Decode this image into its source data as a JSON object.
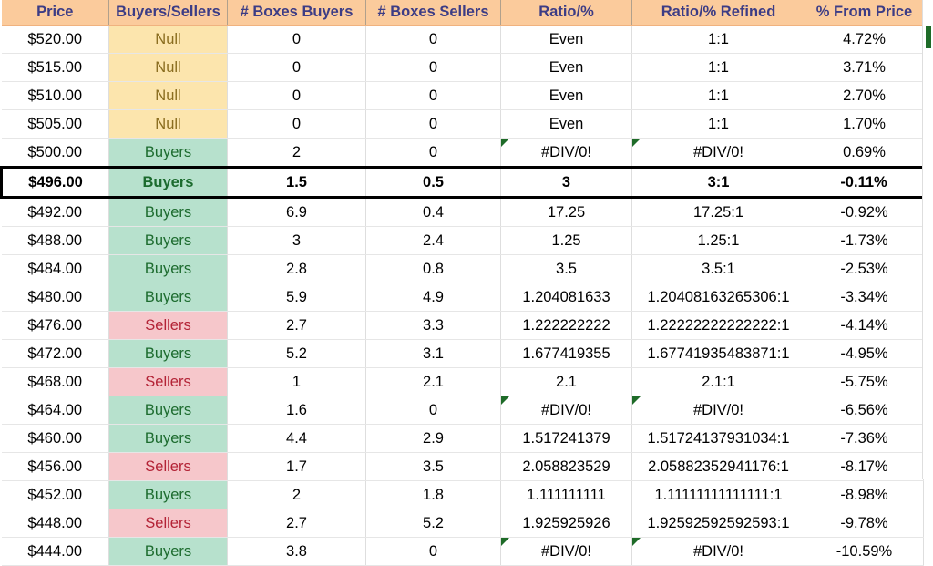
{
  "table": {
    "columns": [
      {
        "key": "price",
        "label": "Price"
      },
      {
        "key": "bs",
        "label": "Buyers/Sellers"
      },
      {
        "key": "bb",
        "label": "# Boxes Buyers"
      },
      {
        "key": "bsl",
        "label": "# Boxes Sellers"
      },
      {
        "key": "ratio",
        "label": "Ratio/%"
      },
      {
        "key": "refined",
        "label": "Ratio/% Refined"
      },
      {
        "key": "pct",
        "label": "% From Price"
      }
    ],
    "rows": [
      {
        "price": "$520.00",
        "bs": "Null",
        "fill": "null",
        "bb": "0",
        "bsl": "0",
        "ratio": "Even",
        "refined": "1:1",
        "pct": "4.72%",
        "ratio_comment": false,
        "refined_comment": false,
        "highlight": false
      },
      {
        "price": "$515.00",
        "bs": "Null",
        "fill": "null",
        "bb": "0",
        "bsl": "0",
        "ratio": "Even",
        "refined": "1:1",
        "pct": "3.71%",
        "ratio_comment": false,
        "refined_comment": false,
        "highlight": false
      },
      {
        "price": "$510.00",
        "bs": "Null",
        "fill": "null",
        "bb": "0",
        "bsl": "0",
        "ratio": "Even",
        "refined": "1:1",
        "pct": "2.70%",
        "ratio_comment": false,
        "refined_comment": false,
        "highlight": false
      },
      {
        "price": "$505.00",
        "bs": "Null",
        "fill": "null",
        "bb": "0",
        "bsl": "0",
        "ratio": "Even",
        "refined": "1:1",
        "pct": "1.70%",
        "ratio_comment": false,
        "refined_comment": false,
        "highlight": false
      },
      {
        "price": "$500.00",
        "bs": "Buyers",
        "fill": "buyers",
        "bb": "2",
        "bsl": "0",
        "ratio": "#DIV/0!",
        "refined": "#DIV/0!",
        "pct": "0.69%",
        "ratio_comment": true,
        "refined_comment": true,
        "highlight": false
      },
      {
        "price": "$496.00",
        "bs": "Buyers",
        "fill": "buyers",
        "bb": "1.5",
        "bsl": "0.5",
        "ratio": "3",
        "refined": "3:1",
        "pct": "-0.11%",
        "ratio_comment": false,
        "refined_comment": false,
        "highlight": true
      },
      {
        "price": "$492.00",
        "bs": "Buyers",
        "fill": "buyers",
        "bb": "6.9",
        "bsl": "0.4",
        "ratio": "17.25",
        "refined": "17.25:1",
        "pct": "-0.92%",
        "ratio_comment": false,
        "refined_comment": false,
        "highlight": false
      },
      {
        "price": "$488.00",
        "bs": "Buyers",
        "fill": "buyers",
        "bb": "3",
        "bsl": "2.4",
        "ratio": "1.25",
        "refined": "1.25:1",
        "pct": "-1.73%",
        "ratio_comment": false,
        "refined_comment": false,
        "highlight": false
      },
      {
        "price": "$484.00",
        "bs": "Buyers",
        "fill": "buyers",
        "bb": "2.8",
        "bsl": "0.8",
        "ratio": "3.5",
        "refined": "3.5:1",
        "pct": "-2.53%",
        "ratio_comment": false,
        "refined_comment": false,
        "highlight": false
      },
      {
        "price": "$480.00",
        "bs": "Buyers",
        "fill": "buyers",
        "bb": "5.9",
        "bsl": "4.9",
        "ratio": "1.204081633",
        "refined": "1.20408163265306:1",
        "pct": "-3.34%",
        "ratio_comment": false,
        "refined_comment": false,
        "highlight": false
      },
      {
        "price": "$476.00",
        "bs": "Sellers",
        "fill": "sellers",
        "bb": "2.7",
        "bsl": "3.3",
        "ratio": "1.222222222",
        "refined": "1.22222222222222:1",
        "pct": "-4.14%",
        "ratio_comment": false,
        "refined_comment": false,
        "highlight": false
      },
      {
        "price": "$472.00",
        "bs": "Buyers",
        "fill": "buyers",
        "bb": "5.2",
        "bsl": "3.1",
        "ratio": "1.677419355",
        "refined": "1.67741935483871:1",
        "pct": "-4.95%",
        "ratio_comment": false,
        "refined_comment": false,
        "highlight": false
      },
      {
        "price": "$468.00",
        "bs": "Sellers",
        "fill": "sellers",
        "bb": "1",
        "bsl": "2.1",
        "ratio": "2.1",
        "refined": "2.1:1",
        "pct": "-5.75%",
        "ratio_comment": false,
        "refined_comment": false,
        "highlight": false
      },
      {
        "price": "$464.00",
        "bs": "Buyers",
        "fill": "buyers",
        "bb": "1.6",
        "bsl": "0",
        "ratio": "#DIV/0!",
        "refined": "#DIV/0!",
        "pct": "-6.56%",
        "ratio_comment": true,
        "refined_comment": true,
        "highlight": false
      },
      {
        "price": "$460.00",
        "bs": "Buyers",
        "fill": "buyers",
        "bb": "4.4",
        "bsl": "2.9",
        "ratio": "1.517241379",
        "refined": "1.51724137931034:1",
        "pct": "-7.36%",
        "ratio_comment": false,
        "refined_comment": false,
        "highlight": false
      },
      {
        "price": "$456.00",
        "bs": "Sellers",
        "fill": "sellers",
        "bb": "1.7",
        "bsl": "3.5",
        "ratio": "2.058823529",
        "refined": "2.05882352941176:1",
        "pct": "-8.17%",
        "ratio_comment": false,
        "refined_comment": false,
        "highlight": false
      },
      {
        "price": "$452.00",
        "bs": "Buyers",
        "fill": "buyers",
        "bb": "2",
        "bsl": "1.8",
        "ratio": "1.111111111",
        "refined": "1.11111111111111:1",
        "pct": "-8.98%",
        "ratio_comment": false,
        "refined_comment": false,
        "highlight": false
      },
      {
        "price": "$448.00",
        "bs": "Sellers",
        "fill": "sellers",
        "bb": "2.7",
        "bsl": "5.2",
        "ratio": "1.925925926",
        "refined": "1.92592592592593:1",
        "pct": "-9.78%",
        "ratio_comment": false,
        "refined_comment": false,
        "highlight": false
      },
      {
        "price": "$444.00",
        "bs": "Buyers",
        "fill": "buyers",
        "bb": "3.8",
        "bsl": "0",
        "ratio": "#DIV/0!",
        "refined": "#DIV/0!",
        "pct": "-10.59%",
        "ratio_comment": true,
        "refined_comment": true,
        "highlight": false
      }
    ]
  },
  "colors": {
    "header_fill": "#fbcb9c",
    "header_text": "#3c3c85",
    "null_fill": "#fce5ad",
    "null_text": "#8a6d1f",
    "buyers_fill": "#b7e1cd",
    "buyers_text": "#1c6b2e",
    "sellers_fill": "#f6c7cb",
    "sellers_text": "#b32336",
    "comment_flag": "#1e6b28"
  }
}
